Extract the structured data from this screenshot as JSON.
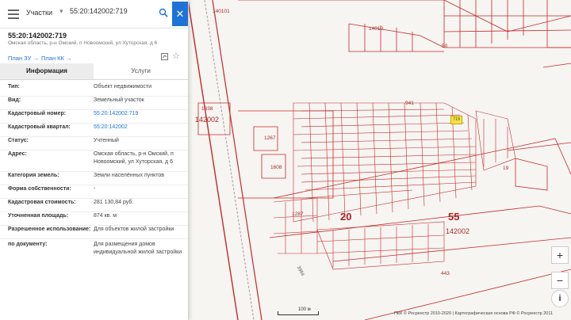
{
  "search": {
    "type_label": "Участки",
    "value": "55:20:142002:719"
  },
  "object": {
    "title": "55:20:142002:719",
    "address": "Омская область, р-н Омский, п Новоомский, ул Хуторская, д 6"
  },
  "links": {
    "plan_zu": "План ЗУ →",
    "plan_kk": "План КК →"
  },
  "tabs": {
    "info": "Информация",
    "services": "Услуги"
  },
  "rows": [
    {
      "key": "Тип:",
      "value": "Объект недвижимости"
    },
    {
      "key": "Вид:",
      "value": "Земельный участок"
    },
    {
      "key": "Кадастровый номер:",
      "value": "55:20:142002:719"
    },
    {
      "key": "Кадастровый квартал:",
      "value": "55:20:142002"
    },
    {
      "key": "Статус:",
      "value": "Учтенный"
    },
    {
      "key": "Адрес:",
      "value": "Омская область, р-н Омский, п Новоомский, ул Хуторская, д 6"
    },
    {
      "key": "Категория земель:",
      "value": "Земли населённых пунктов"
    },
    {
      "key": "Форма собственности:",
      "value": "-"
    },
    {
      "key": "Кадастровая стоимость:",
      "value": "281 130,84 руб."
    },
    {
      "key": "Уточненная площадь:",
      "value": "874 кв. м"
    },
    {
      "key": "Разрешенное использование:",
      "value": "Для объектов жилой застройки"
    },
    {
      "key": "по документу:",
      "value": "Для размещения домов индивидуальной жилой застройки"
    }
  ],
  "map": {
    "labels": {
      "l140101": "140101",
      "l140102": "14010",
      "l1338": "1338",
      "l142002a": "142002",
      "l1267": "1267",
      "l1608": "1608",
      "l1287": "1287",
      "l20": "20",
      "l55": "55",
      "l142002b": "142002",
      "l443": "443",
      "l941": "941",
      "l50": "50",
      "l719": "719",
      "l3984": "3984",
      "l19": "19"
    },
    "controls": {
      "zoom_in": "+",
      "zoom_out": "−",
      "info": "i"
    },
    "scale_label": "100 м",
    "copyright": "ПКК © Росреестр 2010-2020 | Картографическая основа РФ © Росреестр 2011",
    "colors": {
      "parcel_line": "#c62828",
      "highlight": "#f5e642",
      "accent": "#1e73d8"
    }
  }
}
